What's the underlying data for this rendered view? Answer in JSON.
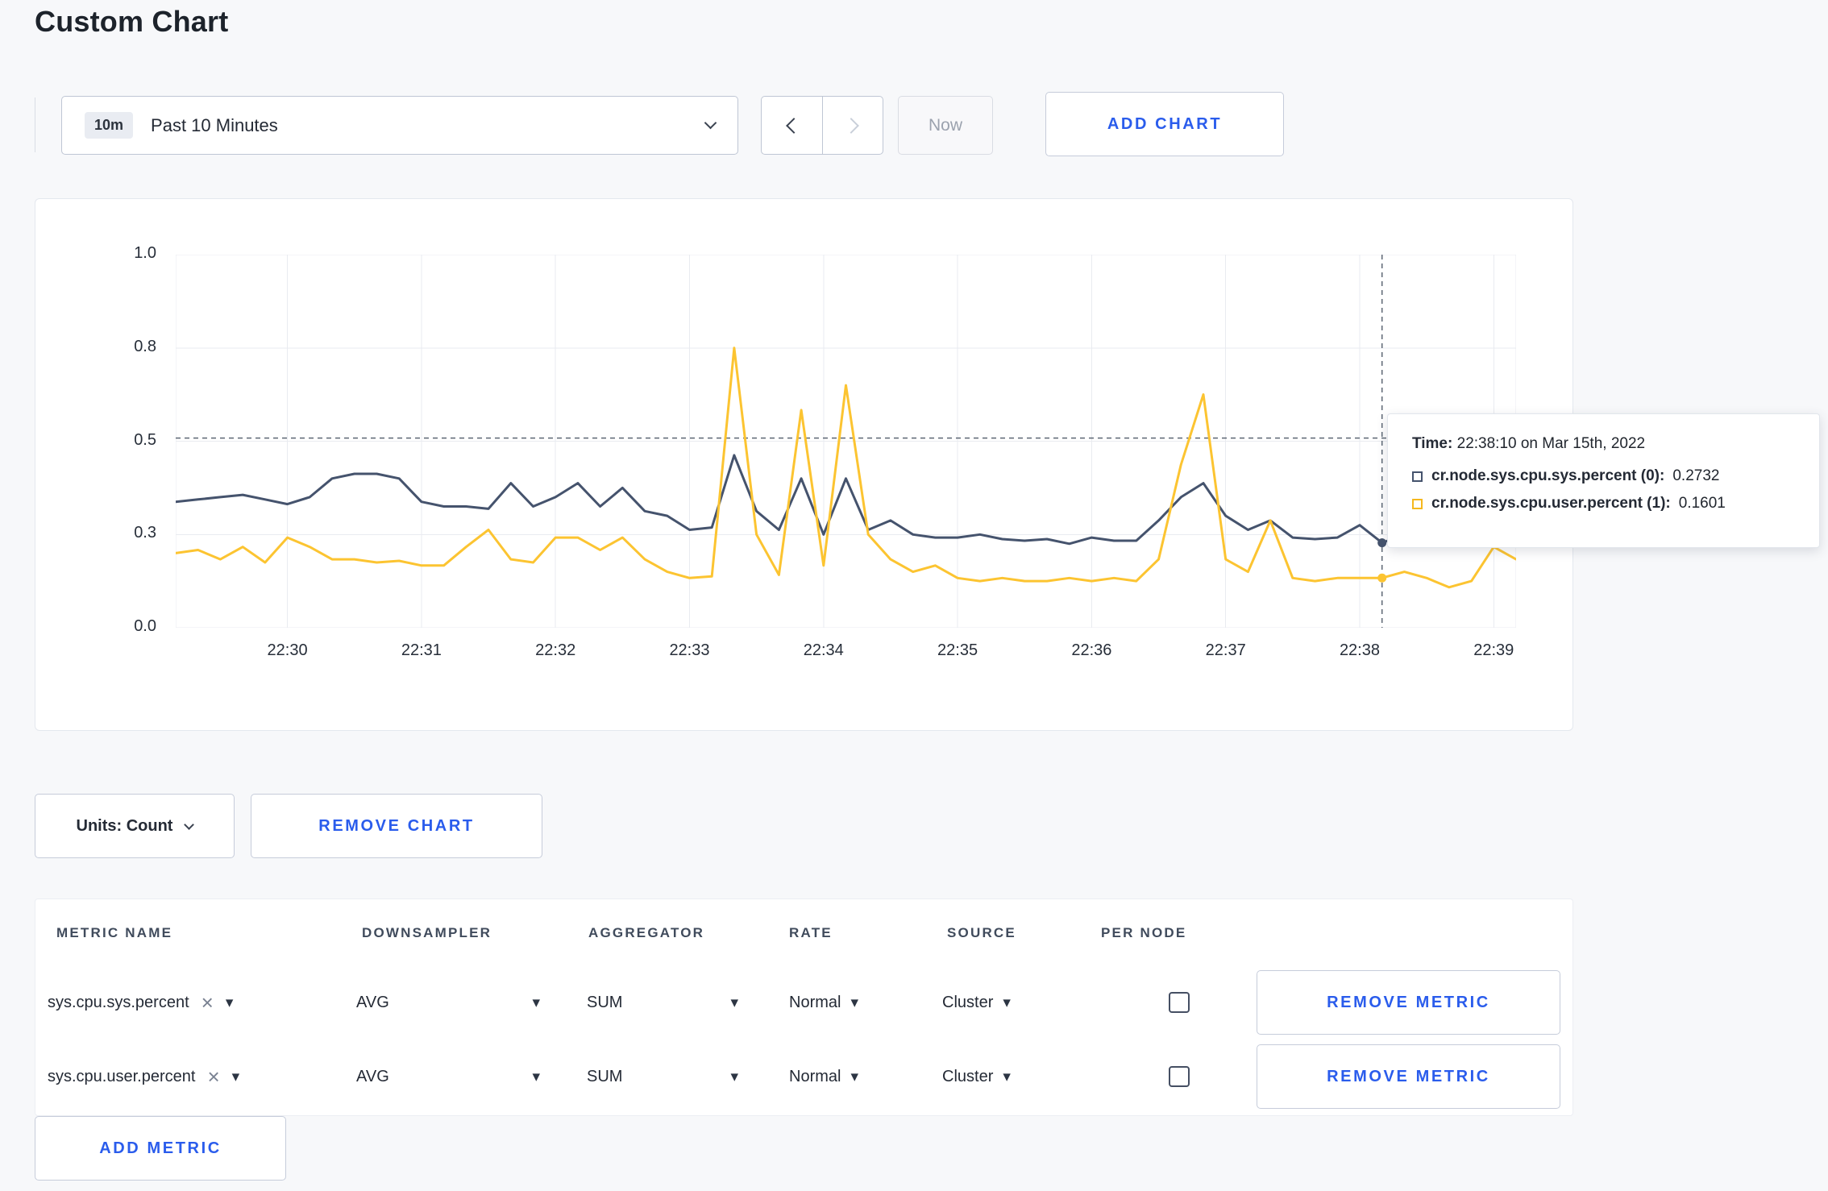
{
  "page": {
    "title": "Custom Chart"
  },
  "colors": {
    "accent_blue": "#2a5cec",
    "series_sys": "#45536d",
    "series_user": "#fcc431",
    "gridline": "#e9ebf0",
    "crosshair": "#5c6673"
  },
  "icons": {
    "caret_down": "▾",
    "close": "×"
  },
  "toolbar": {
    "time_range": {
      "badge": "10m",
      "label": "Past 10 Minutes"
    },
    "now_label": "Now",
    "add_chart_label": "ADD CHART"
  },
  "chart_data": {
    "type": "line",
    "title": "",
    "xlabel": "",
    "ylabel": "",
    "ylim": [
      0,
      1
    ],
    "x_start_label": "22:29:10",
    "x_interval_seconds": 10,
    "x_tick_offsets_seconds": [
      50,
      110,
      170,
      230,
      290,
      350,
      410,
      470,
      530,
      590
    ],
    "x_tick_labels": [
      "22:30",
      "22:31",
      "22:32",
      "22:33",
      "22:34",
      "22:35",
      "22:36",
      "22:37",
      "22:38",
      "22:39"
    ],
    "y_ticks": [
      0.0,
      0.3,
      0.5,
      0.8,
      1.0
    ],
    "y_tick_labels": [
      "0.0",
      "0.3",
      "0.5",
      "0.8",
      "1.0"
    ],
    "grid": true,
    "legend_position": "none",
    "series": [
      {
        "name": "cr.node.sys.cpu.sys.percent",
        "color": "#45536d",
        "values": [
          0.37,
          0.375,
          0.38,
          0.385,
          0.375,
          0.365,
          0.38,
          0.42,
          0.43,
          0.43,
          0.42,
          0.37,
          0.36,
          0.36,
          0.355,
          0.41,
          0.36,
          0.38,
          0.41,
          0.36,
          0.4,
          0.35,
          0.34,
          0.31,
          0.315,
          0.47,
          0.35,
          0.31,
          0.42,
          0.3,
          0.42,
          0.31,
          0.33,
          0.3,
          0.29,
          0.29,
          0.3,
          0.285,
          0.28,
          0.285,
          0.27,
          0.29,
          0.28,
          0.28,
          0.33,
          0.38,
          0.41,
          0.34,
          0.31,
          0.33,
          0.29,
          0.285,
          0.29,
          0.32,
          0.2732,
          0.3,
          0.31,
          0.3,
          0.3,
          0.31,
          0.31
        ]
      },
      {
        "name": "cr.node.sys.cpu.user.percent",
        "color": "#fcc431",
        "values": [
          0.24,
          0.25,
          0.22,
          0.26,
          0.21,
          0.29,
          0.26,
          0.22,
          0.22,
          0.21,
          0.215,
          0.2,
          0.2,
          0.26,
          0.31,
          0.22,
          0.21,
          0.29,
          0.29,
          0.25,
          0.29,
          0.22,
          0.18,
          0.16,
          0.165,
          0.8,
          0.3,
          0.17,
          0.6,
          0.2,
          0.68,
          0.3,
          0.22,
          0.18,
          0.2,
          0.16,
          0.15,
          0.16,
          0.15,
          0.15,
          0.16,
          0.15,
          0.16,
          0.15,
          0.22,
          0.45,
          0.65,
          0.22,
          0.18,
          0.33,
          0.16,
          0.15,
          0.16,
          0.16,
          0.1601,
          0.18,
          0.16,
          0.13,
          0.15,
          0.26,
          0.22
        ]
      }
    ],
    "crosshair": {
      "x_offset_seconds": 540,
      "y_value": 0.51,
      "time_label": "22:38:10"
    }
  },
  "tooltip": {
    "time_prefix": "Time:",
    "time_value": "22:38:10 on Mar 15th, 2022",
    "entries": [
      {
        "label": "cr.node.sys.cpu.sys.percent (0):",
        "value": "0.2732",
        "color": "#45536d"
      },
      {
        "label": "cr.node.sys.cpu.user.percent (1):",
        "value": "0.1601",
        "color": "#f5b81e"
      }
    ]
  },
  "controls": {
    "units_label": "Units: Count",
    "remove_chart_label": "REMOVE CHART",
    "add_metric_label": "ADD METRIC"
  },
  "metrics_table": {
    "headers": [
      "METRIC NAME",
      "DOWNSAMPLER",
      "AGGREGATOR",
      "RATE",
      "SOURCE",
      "PER NODE"
    ],
    "rows": [
      {
        "metric": "sys.cpu.sys.percent",
        "downsampler": "AVG",
        "aggregator": "SUM",
        "rate": "Normal",
        "source": "Cluster",
        "per_node_checked": false,
        "remove_label": "REMOVE METRIC"
      },
      {
        "metric": "sys.cpu.user.percent",
        "downsampler": "AVG",
        "aggregator": "SUM",
        "rate": "Normal",
        "source": "Cluster",
        "per_node_checked": false,
        "remove_label": "REMOVE METRIC"
      }
    ]
  }
}
